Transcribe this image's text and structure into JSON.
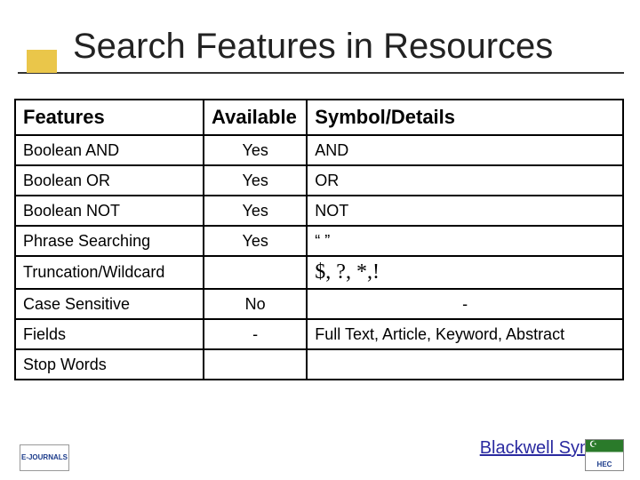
{
  "title": "Search Features in Resources",
  "table": {
    "headers": {
      "c1": "Features",
      "c2": "Available",
      "c3": "Symbol/Details"
    },
    "rows": [
      {
        "feature": "Boolean AND",
        "available": "Yes",
        "detail": "AND"
      },
      {
        "feature": "Boolean OR",
        "available": "Yes",
        "detail": "OR"
      },
      {
        "feature": "Boolean NOT",
        "available": "Yes",
        "detail": "NOT"
      },
      {
        "feature": "Phrase Searching",
        "available": "Yes",
        "detail": "“ ”"
      },
      {
        "feature": "Truncation/Wildcard",
        "available": "",
        "detail": "$, ?, *,!"
      },
      {
        "feature": "Case Sensitive",
        "available": "No",
        "detail": "-"
      },
      {
        "feature": "Fields",
        "available": "-",
        "detail": "Full Text, Article, Keyword, Abstract"
      },
      {
        "feature": "Stop Words",
        "available": "",
        "detail": ""
      }
    ]
  },
  "footer": {
    "link": " Blackwell Synergy",
    "logo1_top": "E-JOURNALS",
    "hec": "HEC"
  }
}
